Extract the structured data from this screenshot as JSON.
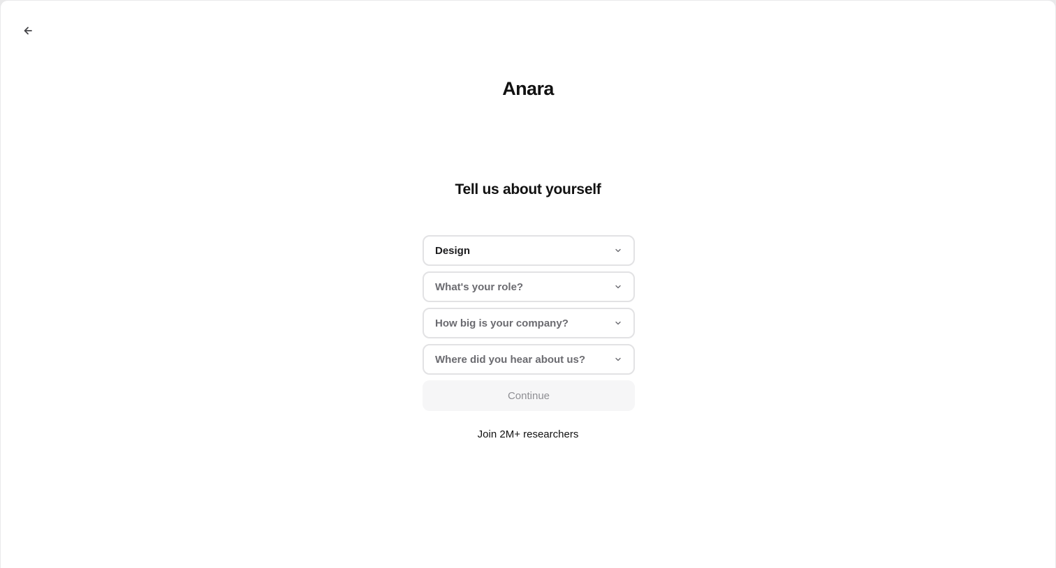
{
  "header": {
    "back_icon": "arrow-left-icon"
  },
  "brand": {
    "name": "Anara"
  },
  "onboarding": {
    "title": "Tell us about yourself",
    "fields": [
      {
        "value": "Design",
        "placeholder": "",
        "icon": "chevron-down-icon"
      },
      {
        "value": "",
        "placeholder": "What's your role?",
        "icon": "chevron-down-icon"
      },
      {
        "value": "",
        "placeholder": "How big is your company?",
        "icon": "chevron-down-icon"
      },
      {
        "value": "",
        "placeholder": "Where did you hear about us?",
        "icon": "chevron-down-icon"
      }
    ],
    "continue_label": "Continue",
    "social_proof": "Join 2M+ researchers"
  },
  "colors": {
    "background": "#ffffff",
    "field_border": "#e2e2e4",
    "placeholder_text": "#6b6b70",
    "filled_text": "#1c1c1e",
    "button_disabled_bg": "#f6f6f7",
    "button_disabled_text": "#8e8e93"
  }
}
